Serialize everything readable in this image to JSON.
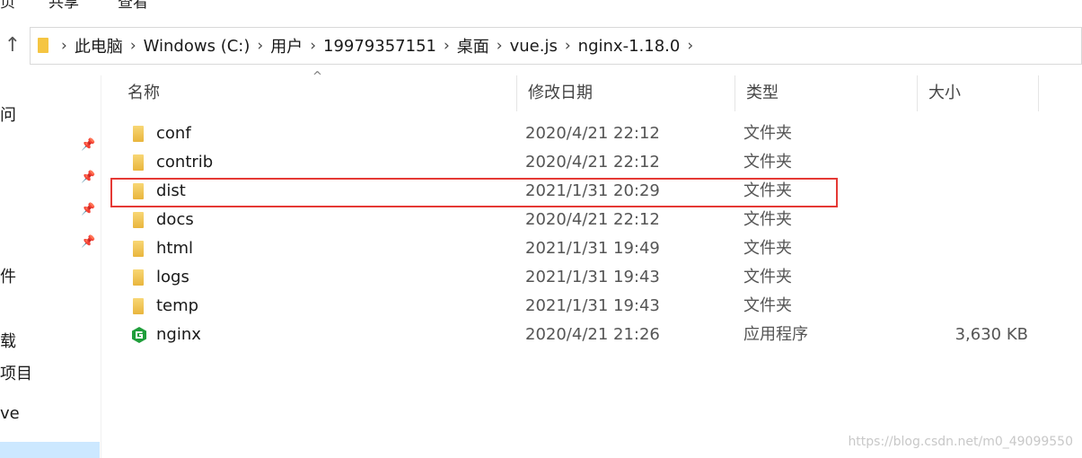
{
  "ribbon": {
    "tabs": [
      "页",
      "共享",
      "查看"
    ]
  },
  "address_bar": {
    "crumbs": [
      "此电脑",
      "Windows (C:)",
      "用户",
      "19979357151",
      "桌面",
      "vue.js",
      "nginx-1.18.0"
    ]
  },
  "nav_pane": {
    "items": [
      "问",
      "件",
      "载",
      "项目",
      "ve"
    ]
  },
  "columns": {
    "name": "名称",
    "modified": "修改日期",
    "type": "类型",
    "size": "大小"
  },
  "files": [
    {
      "name": "conf",
      "modified": "2020/4/21 22:12",
      "type": "文件夹",
      "size": "",
      "icon": "folder-icon"
    },
    {
      "name": "contrib",
      "modified": "2020/4/21 22:12",
      "type": "文件夹",
      "size": "",
      "icon": "folder-icon"
    },
    {
      "name": "dist",
      "modified": "2021/1/31 20:29",
      "type": "文件夹",
      "size": "",
      "icon": "folder-icon"
    },
    {
      "name": "docs",
      "modified": "2020/4/21 22:12",
      "type": "文件夹",
      "size": "",
      "icon": "folder-icon"
    },
    {
      "name": "html",
      "modified": "2021/1/31 19:49",
      "type": "文件夹",
      "size": "",
      "icon": "folder-icon"
    },
    {
      "name": "logs",
      "modified": "2021/1/31 19:43",
      "type": "文件夹",
      "size": "",
      "icon": "folder-icon"
    },
    {
      "name": "temp",
      "modified": "2021/1/31 19:43",
      "type": "文件夹",
      "size": "",
      "icon": "folder-icon"
    },
    {
      "name": "nginx",
      "modified": "2020/4/21 21:26",
      "type": "应用程序",
      "size": "3,630 KB",
      "icon": "nginx-app-icon"
    }
  ],
  "watermark": "https://blog.csdn.net/m0_49099550",
  "colors": {
    "highlight": "#e53935",
    "folder": "#f5c542",
    "nginx_green": "#1e9e3a"
  }
}
